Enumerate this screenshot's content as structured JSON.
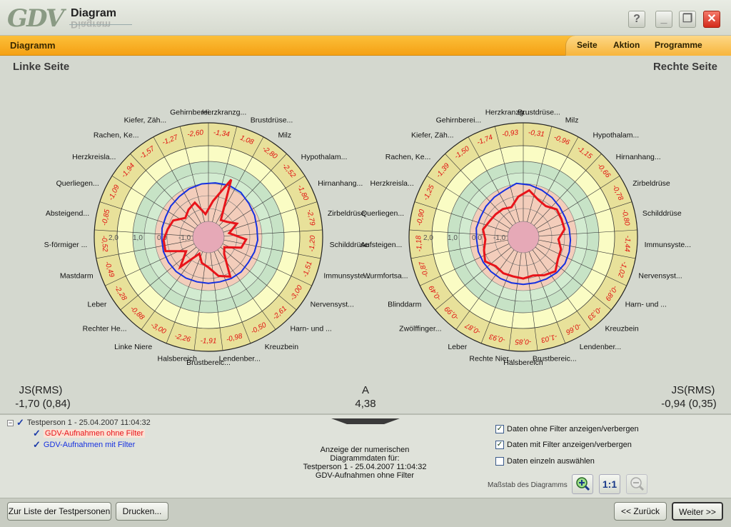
{
  "app": {
    "logo": "GDV",
    "logo_word": "Diagram"
  },
  "window_buttons": {
    "help": "?",
    "minimize": "_",
    "restore": "❐",
    "close": "✕"
  },
  "menubar": {
    "title": "Diagramm",
    "items": [
      "Seite",
      "Aktion",
      "Programme"
    ]
  },
  "colors": {
    "accent": "#f5a114",
    "without_filter": "#e8141a",
    "with_filter": "#1530e0",
    "values": "#e01010"
  },
  "left": {
    "title": "Linke Seite",
    "stat_label": "JS(RMS)",
    "stat_value": "-1,70 (0,84)",
    "sectors": [
      "Herzkranzg...",
      "Brustdrüse...",
      "Milz",
      "Hypothalam...",
      "Hirnanhang...",
      "Zirbeldrüse",
      "Schilddrüse",
      "Immunsyste...",
      "Nervensyst...",
      "Harn- und ...",
      "Kreuzbein",
      "Lendenber...",
      "Brustbereic...",
      "Halsbereich",
      "Linke Niere",
      "Rechter He...",
      "Leber",
      "Mastdarm",
      "S-förmiger ...",
      "Absteigend...",
      "Querliegen...",
      "Herzkreisla...",
      "Rachen, Ke...",
      "Kiefer, Zäh...",
      "Gehirnberei..."
    ],
    "values": [
      "-1,34",
      "1,08",
      "-2,80",
      "-2,52",
      "-1,80",
      "-2,79",
      "-1,20",
      "-1,51",
      "-3,00",
      "-2,61",
      "-0,50",
      "-0,98",
      "-1,91",
      "-2,26",
      "-3,00",
      "-0,88",
      "-2,28",
      "-0,49",
      "-0,52",
      "-0,85",
      "-1,09",
      "-1,94",
      "-1,57",
      "-1,27",
      "-2,60"
    ],
    "ring_labels": [
      "2,0",
      "1,0",
      "0,0",
      "-1,0"
    ],
    "red_series": [
      -1.34,
      1.08,
      -2.8,
      -2.52,
      -1.8,
      -2.79,
      -1.2,
      -1.51,
      -3.0,
      -2.61,
      -0.5,
      -0.98,
      -1.91,
      -2.26,
      -3.0,
      -0.88,
      -2.28,
      -0.49,
      -0.52,
      -0.85,
      -1.09,
      -1.94,
      -1.57,
      -1.27,
      -2.6
    ],
    "blue_series": [
      0.4,
      0.5,
      0.45,
      0.2,
      0.05,
      -0.1,
      -0.1,
      -0.2,
      -0.3,
      -0.25,
      -0.3,
      -0.4,
      -0.4,
      -0.4,
      -0.35,
      -0.3,
      -0.3,
      -0.3,
      -0.35,
      -0.3,
      -0.3,
      -0.15,
      -0.05,
      0.15,
      0.3
    ]
  },
  "right": {
    "title": "Rechte Seite",
    "stat_label": "JS(RMS)",
    "stat_value": "-0,94 (0,35)",
    "sectors": [
      "Herzkranzg...",
      "Gehirnberei...",
      "Kiefer, Zäh...",
      "Rachen, Ke...",
      "Herzkreisla...",
      "Querliegen...",
      "Aufsteigen...",
      "Wurmfortsa...",
      "Blinddarm",
      "Zwölffinger...",
      "Leber",
      "Rechte Nier...",
      "Halsbereich",
      "Brustbereic...",
      "Lendenber...",
      "Kreuzbein",
      "Harn- und ...",
      "Nervensyst...",
      "Immunsyste...",
      "Schilddrüse",
      "Zirbeldrüse",
      "Hirnanhang...",
      "Hypothalam...",
      "Milz",
      "Brustdrüse..."
    ],
    "values": [
      "-0,93",
      "-1,74",
      "-1,50",
      "-1,39",
      "-1,25",
      "-0,90",
      "-1,18",
      "-0,87",
      "-0,49",
      "-0,99",
      "-0,87",
      "-0,93",
      "-0,85",
      "-1,03",
      "-0,66",
      "-0,33",
      "-0,89",
      "-1,02",
      "-1,44",
      "-0,80",
      "-0,78",
      "-0,66",
      "-1,15",
      "-0,96",
      "-0,31"
    ],
    "ring_labels": [
      "2,0",
      "1,0",
      "0,0",
      "-1,0"
    ],
    "red_series": [
      -0.93,
      -1.74,
      -1.5,
      -1.39,
      -1.25,
      -0.9,
      -1.18,
      -0.87,
      -0.49,
      -0.99,
      -0.87,
      -0.93,
      -0.85,
      -1.03,
      -0.66,
      -0.33,
      -0.89,
      -1.02,
      -1.44,
      -0.8,
      -0.78,
      -0.66,
      -1.15,
      -0.96,
      -0.31
    ],
    "blue_series": [
      0.35,
      0.0,
      -0.1,
      -0.2,
      -0.3,
      -0.25,
      -0.35,
      -0.3,
      -0.3,
      -0.3,
      -0.3,
      -0.3,
      -0.3,
      -0.3,
      -0.25,
      -0.15,
      -0.1,
      -0.2,
      -0.3,
      -0.35,
      -0.4,
      -0.3,
      -0.15,
      0.0,
      0.2
    ]
  },
  "center_stat": {
    "label": "A",
    "value": "4,38"
  },
  "tree": {
    "root": "Testperson 1 - 25.04.2007 11:04:32",
    "children": [
      {
        "label": "GDV-Aufnahmen ohne Filter"
      },
      {
        "label": "GDV-Aufnahmen mit Filter"
      }
    ]
  },
  "options": {
    "show_without_filter": "Daten ohne Filter anzeigen/verbergen",
    "show_with_filter": "Daten mit Filter anzeigen/verbergen",
    "select_single": "Daten einzeln auswählen"
  },
  "info": {
    "line1": "Anzeige der numerischen",
    "line2": "Diagrammdaten für:",
    "line3": "Testperson 1 - 25.04.2007 11:04:32",
    "line4": "GDV-Aufnahmen ohne Filter"
  },
  "scale": {
    "label": "Maßstab des Diagramms",
    "one_to_one": "1:1"
  },
  "footer": {
    "list_button": "Zur Liste der Testpersonen",
    "print_button": "Drucken...",
    "back_button": "<< Zurück",
    "next_button": "Weiter >>"
  }
}
